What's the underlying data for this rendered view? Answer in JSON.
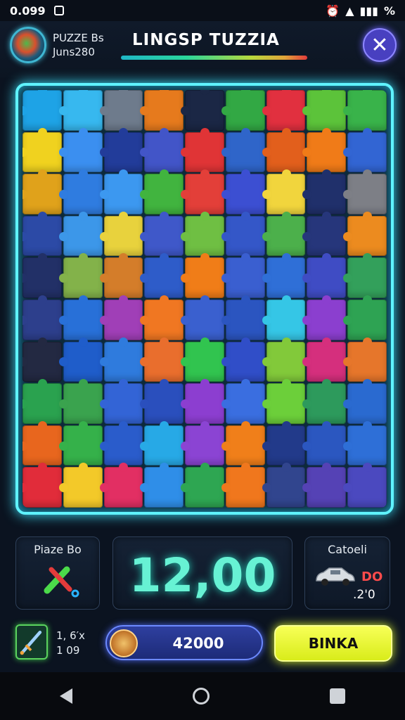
{
  "status_bar": {
    "time": "0.099",
    "battery": "%"
  },
  "header": {
    "player_line1": "PUZZE Bs",
    "player_line2": "Jun​s280",
    "title": "LINGSP TUZZIA",
    "close_icon": "close-icon"
  },
  "board": {
    "rows": 10,
    "cols": 9,
    "colors": [
      [
        "#1ea3e6",
        "#37b8ef",
        "#6e7b8c",
        "#e67a1d",
        "#1b2745",
        "#32a844",
        "#e1303f",
        "#5cc33a",
        "#39b34a"
      ],
      [
        "#f0d21f",
        "#3b8ff0",
        "#223c9a",
        "#4255c8",
        "#e03436",
        "#2f65c9",
        "#e25f1c",
        "#f07b18",
        "#3265d3"
      ],
      [
        "#e0a21b",
        "#2f7ce0",
        "#3c98f0",
        "#41b43f",
        "#e33f39",
        "#3c4fd2",
        "#f1d53d",
        "#20306b",
        "#7d7f86"
      ],
      [
        "#2c4aa6",
        "#3c97e9",
        "#e8d23d",
        "#3f58c9",
        "#6fbf43",
        "#3457c8",
        "#4cb04b",
        "#26367b",
        "#ec8b1f"
      ],
      [
        "#223067",
        "#83b24a",
        "#d47d2a",
        "#2e5cc9",
        "#f07d18",
        "#3a5fd0",
        "#2f6fd7",
        "#3f4cc4",
        "#33a05b"
      ],
      [
        "#2d3f8c",
        "#2870d8",
        "#a03fb7",
        "#f07722",
        "#3a60cf",
        "#2b55c0",
        "#35c6e6",
        "#8b3fcf",
        "#2ea353"
      ],
      [
        "#232942",
        "#1f5dca",
        "#2f7bdd",
        "#e96e2d",
        "#31c44f",
        "#304ec8",
        "#82c93a",
        "#d52f7d",
        "#e6762b"
      ],
      [
        "#2aa24f",
        "#3aa34e",
        "#3364d6",
        "#2a4fbd",
        "#8c3ed0",
        "#3a6ee0",
        "#6ccf3a",
        "#2d9a5c",
        "#2a6ad0"
      ],
      [
        "#e8661e",
        "#35b14a",
        "#2a5ccb",
        "#27a9e6",
        "#8b44d3",
        "#f07f1a",
        "#223a8a",
        "#2b57c0",
        "#2e6fd7"
      ],
      [
        "#e12c3a",
        "#f3c929",
        "#e22f63",
        "#2f8ee8",
        "#2ea652",
        "#f0771d",
        "#31458e",
        "#5542b5",
        "#4b49bf"
      ]
    ]
  },
  "stats": {
    "left_label": "Piaze Bo",
    "left_icon": "tools-icon",
    "score": "12,00",
    "right_label": "Catoeli",
    "right_icon": "car-icon",
    "right_red": "DO",
    "right_sub": ".2'0"
  },
  "footer": {
    "left_icon": "sword-icon",
    "mini_line1": "1, 6′x",
    "mini_line2": "1 09",
    "coin_value": "42000",
    "action_label": "BINKA"
  }
}
